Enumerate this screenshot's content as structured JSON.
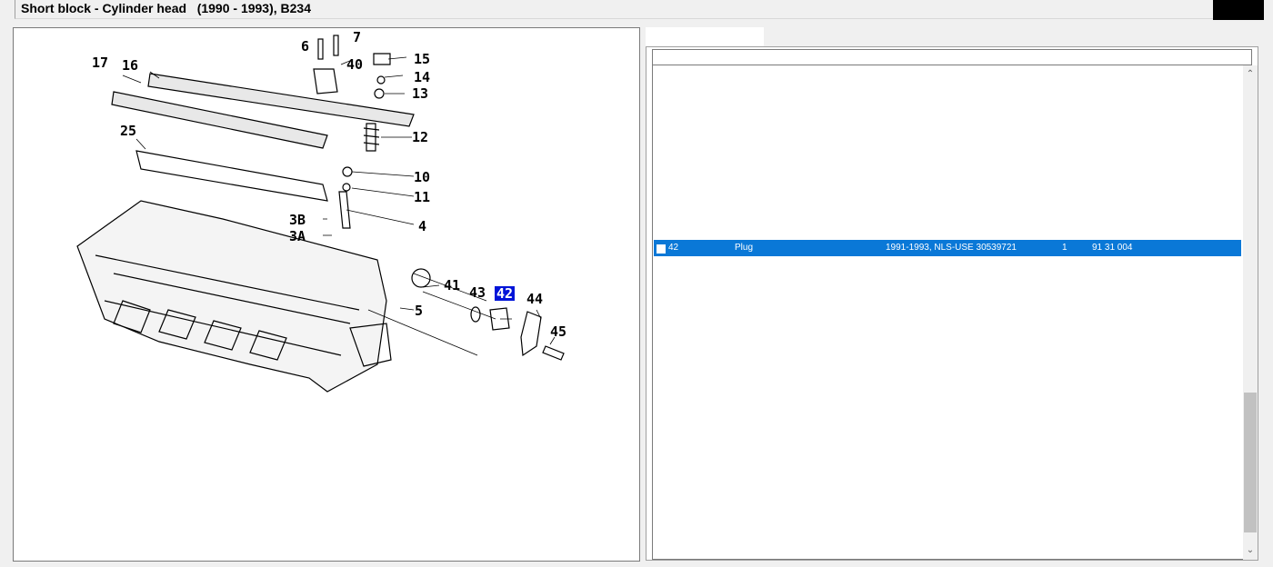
{
  "window": {
    "title": "Short block - Cylinder head   (1990 - 1993), B234"
  },
  "diagram": {
    "selected_callout": "42",
    "callouts": [
      {
        "label": "6"
      },
      {
        "label": "7"
      },
      {
        "label": "40"
      },
      {
        "label": "15"
      },
      {
        "label": "14"
      },
      {
        "label": "13"
      },
      {
        "label": "17"
      },
      {
        "label": "16"
      },
      {
        "label": "25"
      },
      {
        "label": "12"
      },
      {
        "label": "10"
      },
      {
        "label": "11"
      },
      {
        "label": "3B"
      },
      {
        "label": "4"
      },
      {
        "label": "3A"
      },
      {
        "label": "41"
      },
      {
        "label": "43"
      },
      {
        "label": "42"
      },
      {
        "label": "44"
      },
      {
        "label": "5"
      },
      {
        "label": "45"
      }
    ]
  },
  "parts_list": {
    "rows": [
      {
        "position": "42",
        "description": "Plug",
        "remarks": "1991-1993, NLS-USE 30539721",
        "quantity": "1",
        "part_number": "91 31 004",
        "selected": true
      }
    ]
  },
  "colors": {
    "selection": "#0a78d7",
    "callout_highlight": "#0014d8"
  },
  "icons": {
    "scroll_up": "chevron-up-icon",
    "scroll_down": "chevron-down-icon"
  }
}
